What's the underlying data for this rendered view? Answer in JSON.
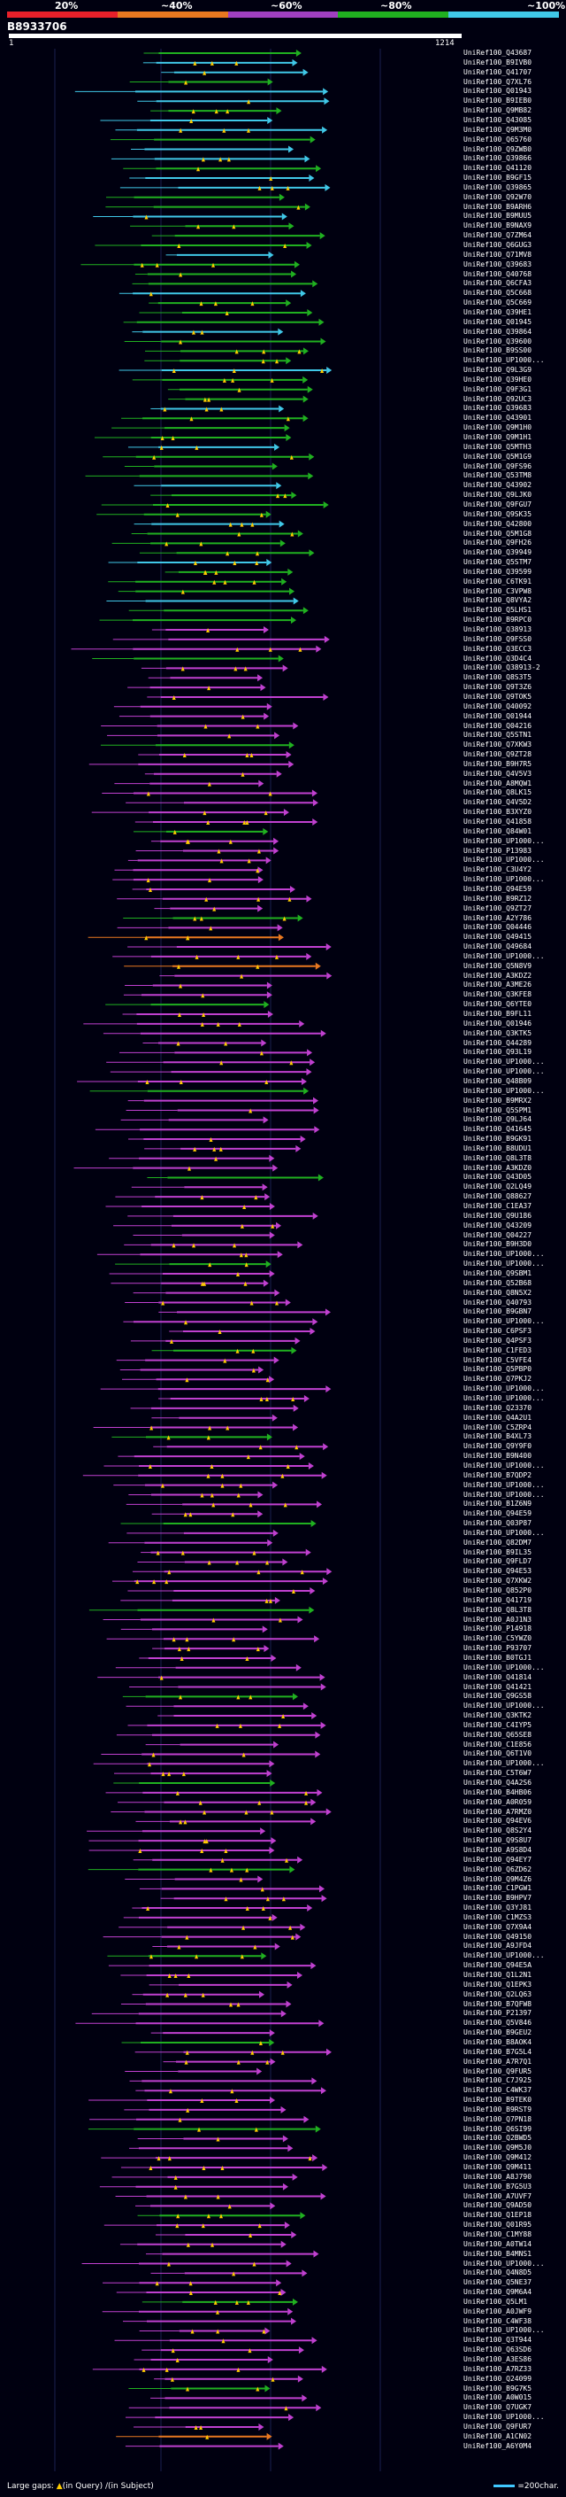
{
  "legend": {
    "labels": [
      "20%",
      "~40%",
      "~60%",
      "~80%",
      "~100%"
    ],
    "colors": [
      "#e8202a",
      "#e87820",
      "#a040c0",
      "#20b020",
      "#40c8e8"
    ]
  },
  "query": {
    "id": "B8933706",
    "start": "1",
    "end": "1214"
  },
  "hits": [
    "UniRef100_Q43687",
    "UniRef100_B9IVB0",
    "UniRef100_Q41707",
    "UniRef100_Q7XL76",
    "UniRef100_Q01943",
    "UniRef100_B9IEB0",
    "UniRef100_Q9MB82",
    "UniRef100_Q43085",
    "UniRef100_Q9M3M0",
    "UniRef100_Q65760",
    "UniRef100_Q9ZWB0",
    "UniRef100_Q39866",
    "UniRef100_Q41120",
    "UniRef100_B9GF15",
    "UniRef100_Q39865",
    "UniRef100_Q92W70",
    "UniRef100_B9ARH6",
    "UniRef100_B9MUU5",
    "UniRef100_B9NAX9",
    "UniRef100_Q7ZM64",
    "UniRef100_Q6GUG3",
    "UniRef100_Q71MV8",
    "UniRef100_Q39683",
    "UniRef100_Q40768",
    "UniRef100_Q6CFA3",
    "UniRef100_Q5C668",
    "UniRef100_Q5C669",
    "UniRef100_Q39HE1",
    "UniRef100_Q01945",
    "UniRef100_Q39864",
    "UniRef100_Q39600",
    "UniRef100_B9SS00",
    "UniRef100_UP1000...",
    "UniRef100_Q9L3G9",
    "UniRef100_Q39HE0",
    "UniRef100_Q9F3G1",
    "UniRef100_Q92UC3",
    "UniRef100_Q39683",
    "UniRef100_Q43901",
    "UniRef100_Q9M1H0",
    "UniRef100_Q9M1H1",
    "UniRef100_Q5MTH3",
    "UniRef100_Q5M1G9",
    "UniRef100_Q9FS96",
    "UniRef100_Q53TM8",
    "UniRef100_Q43902",
    "UniRef100_Q9LJK0",
    "UniRef100_Q9FGU7",
    "UniRef100_Q9SK35",
    "UniRef100_Q42800",
    "UniRef100_Q5M1G8",
    "UniRef100_Q9FH26",
    "UniRef100_Q39949",
    "UniRef100_Q5STM7",
    "UniRef100_Q39599",
    "UniRef100_C6TK91",
    "UniRef100_C3VPW8",
    "UniRef100_Q8VYA2",
    "UniRef100_Q5LHS1",
    "UniRef100_B9RPC0",
    "UniRef100_Q38913",
    "UniRef100_Q9FSS0",
    "UniRef100_Q3ECC3",
    "UniRef100_Q3D4C4",
    "UniRef100_Q38913-2",
    "UniRef100_Q8S3T5",
    "UniRef100_Q9T3Z6",
    "UniRef100_Q9TOK5",
    "UniRef100_Q40092",
    "UniRef100_Q01944",
    "UniRef100_Q04216",
    "UniRef100_Q5STN1",
    "UniRef100_Q7XKW3",
    "UniRef100_Q9ZT28",
    "UniRef100_B9H7R5",
    "UniRef100_Q4V5V3",
    "UniRef100_A8MQW1",
    "UniRef100_Q8LK15",
    "UniRef100_Q4V5D2",
    "UniRef100_B3XYZ0",
    "UniRef100_Q41858",
    "UniRef100_Q84W01",
    "UniRef100_UP1000...",
    "UniRef100_P13983",
    "UniRef100_UP1000...",
    "UniRef100_C3U4Y2",
    "UniRef100_UP1000...",
    "UniRef100_Q94E59",
    "UniRef100_B9RZ12",
    "UniRef100_Q9ZT27",
    "UniRef100_A2Y786",
    "UniRef100_Q04446",
    "UniRef100_Q49415",
    "UniRef100_Q49684",
    "UniRef100_UP1000...",
    "UniRef100_Q5N8V9",
    "UniRef100_A3KDZ2",
    "UniRef100_A3ME26",
    "UniRef100_Q3KFE8",
    "UniRef100_Q6YTE0",
    "UniRef100_B9FL11",
    "UniRef100_Q01946",
    "UniRef100_Q3KTK5",
    "UniRef100_Q44289",
    "UniRef100_Q93L19",
    "UniRef100_UP1000...",
    "UniRef100_UP1000...",
    "UniRef100_Q48B09",
    "UniRef100_UP1000...",
    "UniRef100_B9MRX2",
    "UniRef100_Q5SPM1",
    "UniRef100_Q9LJ64",
    "UniRef100_Q41645",
    "UniRef100_B9GK91",
    "UniRef100_B8UDU1",
    "UniRef100_Q8L3T8",
    "UniRef100_A3KDZ0",
    "UniRef100_Q43D05",
    "UniRef100_Q2LQ49",
    "UniRef100_Q88627",
    "UniRef100_C1EA37",
    "UniRef100_Q9U186",
    "UniRef100_Q43209",
    "UniRef100_Q04227",
    "UniRef100_B9H3D0",
    "UniRef100_UP1000...",
    "UniRef100_UP1000...",
    "UniRef100_Q9SBM1",
    "UniRef100_Q52B68",
    "UniRef100_Q8N5X2",
    "UniRef100_Q40793",
    "UniRef100_B9GBN7",
    "UniRef100_UP1000...",
    "UniRef100_C6PSF3",
    "UniRef100_Q4PSF3",
    "UniRef100_C1FED3",
    "UniRef100_C5VFE4",
    "UniRef100_Q5PBP0",
    "UniRef100_Q7PKJ2",
    "UniRef100_UP1000...",
    "UniRef100_UP1000...",
    "UniRef100_Q23370",
    "UniRef100_Q4A2U1",
    "UniRef100_C5ZRP4",
    "UniRef100_B4XL73",
    "UniRef100_Q9Y9F0",
    "UniRef100_B9N400",
    "UniRef100_UP1000...",
    "UniRef100_B7QDP2",
    "UniRef100_UP1000...",
    "UniRef100_UP1000...",
    "UniRef100_B1Z6N9",
    "UniRef100_Q94E59",
    "UniRef100_Q03P87",
    "UniRef100_UP1000...",
    "UniRef100_Q82DM7",
    "UniRef100_B9IL35",
    "UniRef100_Q9FLD7",
    "UniRef100_Q94E53",
    "UniRef100_Q7XKW2",
    "UniRef100_Q852P0",
    "UniRef100_Q41719",
    "UniRef100_Q8L3T8",
    "UniRef100_A0J1N3",
    "UniRef100_P14918",
    "UniRef100_C5YWZ0",
    "UniRef100_P93707",
    "UniRef100_B0TGJ1",
    "UniRef100_UP1000...",
    "UniRef100_Q41814",
    "UniRef100_Q41421",
    "UniRef100_Q9GS58",
    "UniRef100_UP1000...",
    "UniRef100_Q3KTK2",
    "UniRef100_C4IYP5",
    "UniRef100_Q65SE8",
    "UniRef100_C1E856",
    "UniRef100_Q6T1V0",
    "UniRef100_UP1000...",
    "UniRef100_C5T6W7",
    "UniRef100_Q4A2S6",
    "UniRef100_B4HB06",
    "UniRef100_A0R059",
    "UniRef100_A7RMZ0",
    "UniRef100_Q94EV6",
    "UniRef100_Q8S2Y4",
    "UniRef100_Q9S8U7",
    "UniRef100_A9S8D4",
    "UniRef100_Q94EY7",
    "UniRef100_Q6ZD62",
    "UniRef100_Q9M4Z6",
    "UniRef100_C1PGW1",
    "UniRef100_B9HPV7",
    "UniRef100_Q3YJ81",
    "UniRef100_C1MZS3",
    "UniRef100_Q7X9A4",
    "UniRef100_Q49150",
    "UniRef100_A9JFD4",
    "UniRef100_UP1000...",
    "UniRef100_Q94E5A",
    "UniRef100_Q1L2N1",
    "UniRef100_Q1EPK3",
    "UniRef100_Q2LQ63",
    "UniRef100_B7QFW8",
    "UniRef100_P21397",
    "UniRef100_Q5V846",
    "UniRef100_B9GEU2",
    "UniRef100_B8AOK4",
    "UniRef100_B7G5L4",
    "UniRef100_A7R7Q1",
    "UniRef100_Q9FUR5",
    "UniRef100_C7J925",
    "UniRef100_C4WK37",
    "UniRef100_B9TEK0",
    "UniRef100_B9RST9",
    "UniRef100_Q7PN18",
    "UniRef100_Q6SI99",
    "UniRef100_Q2BWD5",
    "UniRef100_Q9M5J0",
    "UniRef100_Q9M412",
    "UniRef100_Q9M411",
    "UniRef100_A8J790",
    "UniRef100_B7G5U3",
    "UniRef100_A7UVF7",
    "UniRef100_Q9AD50",
    "UniRef100_Q1EP18",
    "UniRef100_Q01R95",
    "UniRef100_C1MY88",
    "UniRef100_A0TW14",
    "UniRef100_B4MNS1",
    "UniRef100_UP1000...",
    "UniRef100_Q4N8D5",
    "UniRef100_Q5NE37",
    "UniRef100_Q9M6A4",
    "UniRef100_Q5LM1",
    "UniRef100_A0JWF9",
    "UniRef100_C4WF38",
    "UniRef100_UP1000...",
    "UniRef100_Q3T944",
    "UniRef100_Q63SD6",
    "UniRef100_A3ES86",
    "UniRef100_A7RZ33",
    "UniRef100_Q24099",
    "UniRef100_B9G7K5",
    "UniRef100_A0W015",
    "UniRef100_Q7UGK7",
    "UniRef100_UP1000...",
    "UniRef100_Q9FUR7",
    "UniRef100_A1CN02",
    "UniRef100_A6Y0M4"
  ],
  "footer": {
    "gaps_label": "Large gaps:",
    "in_query": "(in Query)",
    "in_subject": "(in Subject)",
    "scale": "=200char."
  }
}
